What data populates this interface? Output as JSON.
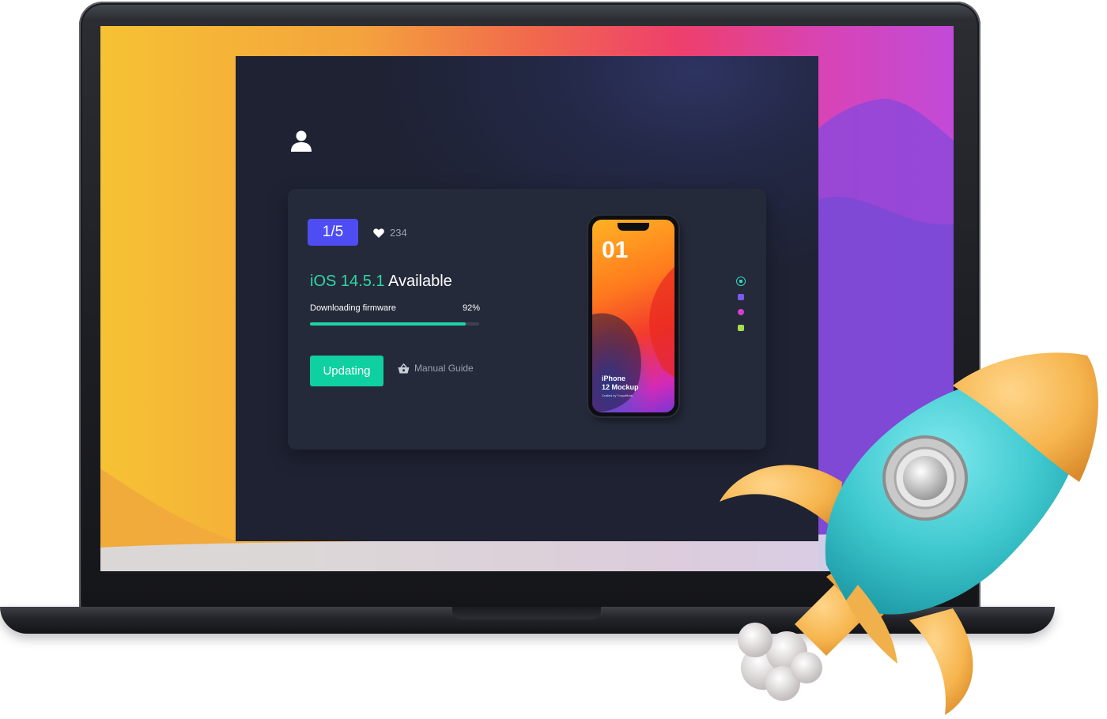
{
  "card": {
    "badge": "1/5",
    "likes": "234",
    "version": "iOS 14.5.1",
    "status": "Available",
    "progress_label": "Downloading firmware",
    "progress_text": "92%",
    "progress_fraction": 0.92,
    "update_button": "Updating",
    "guide_link": "Manual Guide"
  },
  "phone": {
    "number": "01",
    "caption_line1": "iPhone",
    "caption_line2": "12 Mockup",
    "credit": "Crafted by Tonyofficial"
  },
  "colors": {
    "accent_green": "#0fd0a0",
    "badge_blue": "#4d4df3",
    "card_bg": "#252a3a"
  },
  "icons": [
    "user-icon",
    "heart-icon",
    "basket-icon"
  ]
}
